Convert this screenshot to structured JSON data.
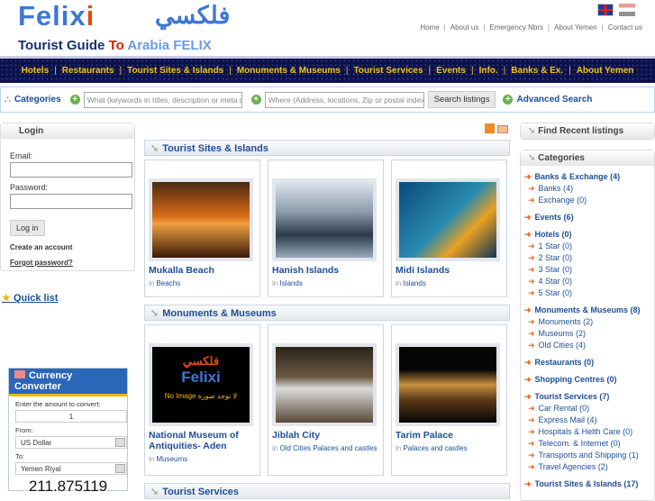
{
  "header": {
    "logo_en": "Felix",
    "logo_en_i": "i",
    "logo_ar": "فلكسي",
    "tagline_1": "Tourist Guide ",
    "tagline_to": "To",
    "tagline_2": " Arabia FELIX",
    "top_links": [
      "Home",
      "About us",
      "Emergency Nbrs",
      "About Yemen",
      "Contact us"
    ]
  },
  "nav": [
    "Hotels",
    "Restaurants",
    "Tourist Sites & Islands",
    "Monuments & Museums",
    "Tourist Services",
    "Events",
    "Info.",
    "Banks & Ex.",
    "About Yemen"
  ],
  "search": {
    "categories": "Categories",
    "what_placeholder": "What (keywords in titles, description or meta da",
    "where_placeholder": "Where (Address, locations, Zip or postal index)",
    "button": "Search listings",
    "advanced": "Advanced Search"
  },
  "login": {
    "title": "Login",
    "email": "Email:",
    "password": "Password:",
    "button": "Log in",
    "create": "Create an account",
    "forgot": "Forgot password?"
  },
  "quick_list": "Quick list",
  "currency": {
    "title": "Currency Converter",
    "amount_label": "Enter the amount to convert:",
    "amount": "1",
    "from_label": "From:",
    "from": "US Dollar",
    "to_label": "To:",
    "to": "Yemen Riyal",
    "result": "211.875119"
  },
  "sections": [
    {
      "title": "Tourist Sites & Islands",
      "items": [
        {
          "name": "Mukalla Beach",
          "in": "in",
          "cats": [
            "Beachs"
          ]
        },
        {
          "name": "Hanish Islands",
          "in": "in",
          "cats": [
            "Islands"
          ]
        },
        {
          "name": "Midi Islands",
          "in": "in",
          "cats": [
            "Islands"
          ]
        }
      ]
    },
    {
      "title": "Monuments & Museums",
      "items": [
        {
          "name": "National Museum of Antiquities- Aden",
          "in": "in",
          "cats": [
            "Museums"
          ],
          "noimg": "No Image",
          "noimg_ar": "لا توجد صورة"
        },
        {
          "name": "Jiblah City",
          "in": "in",
          "cats": [
            "Old Cities",
            "Palaces and castles"
          ]
        },
        {
          "name": "Tarim Palace",
          "in": "in",
          "cats": [
            "Palaces and castles"
          ]
        }
      ]
    },
    {
      "title": "Tourist Services"
    }
  ],
  "right": {
    "recent": "Find Recent listings",
    "categories_title": "Categories",
    "categories": [
      {
        "label": "Banks & Exchange (4)",
        "subs": [
          "Banks (4)",
          "Exchange (0)"
        ]
      },
      {
        "label": "Events (6)",
        "subs": []
      },
      {
        "label": "Hotels (0)",
        "subs": [
          "1 Star (0)",
          "2 Star (0)",
          "3 Star (0)",
          "4 Star (0)",
          "5 Star (0)"
        ]
      },
      {
        "label": "Monuments & Museums (8)",
        "subs": [
          "Monuments (2)",
          "Museums (2)",
          "Old Cities (4)"
        ]
      },
      {
        "label": "Restaurants (0)",
        "subs": []
      },
      {
        "label": "Shopping Centres (0)",
        "subs": []
      },
      {
        "label": "Tourist Services (7)",
        "subs": [
          "Car Rental (0)",
          "Express Mail (4)",
          "Hospitals & Helth Care (0)",
          "Telecom. & Internet (0)",
          "Transports and Shipping (1)",
          "Travel Agencies (2)"
        ]
      },
      {
        "label": "Tourist Sites & Islands (17)",
        "subs": []
      }
    ]
  }
}
